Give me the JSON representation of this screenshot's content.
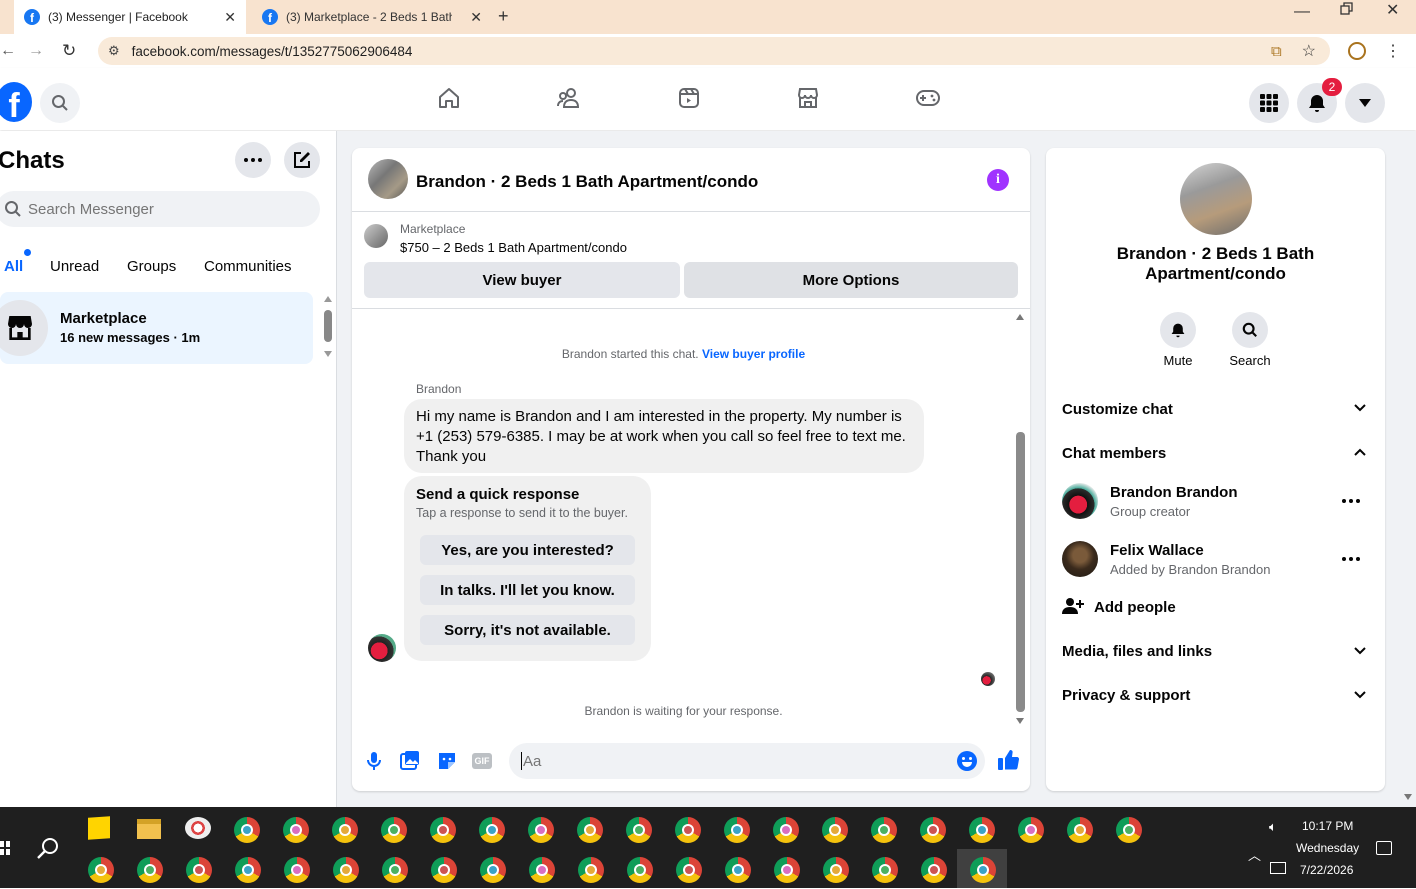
{
  "browser": {
    "tabs": [
      {
        "title": "(3) Messenger | Facebook",
        "active": true
      },
      {
        "title": "(3) Marketplace - 2 Beds 1 Bath"
      }
    ],
    "new_tab": "+",
    "url": "facebook.com/messages/t/1352775062906484"
  },
  "header": {
    "notification_count": "2",
    "nav_icons": [
      "home-icon",
      "friends-icon",
      "video-icon",
      "marketplace-icon",
      "gaming-icon"
    ]
  },
  "left": {
    "title": "Chats",
    "search_placeholder": "Search Messenger",
    "filters": [
      "All",
      "Unread",
      "Groups",
      "Communities"
    ],
    "conversation": {
      "name": "Marketplace",
      "subtitle": "16 new messages · 1m"
    }
  },
  "chat": {
    "title": "Brandon · 2 Beds 1 Bath Apartment/condo",
    "listing": {
      "label": "Marketplace",
      "price_title": "$750 – 2 Beds 1 Bath Apartment/condo"
    },
    "view_buyer": "View buyer",
    "more_options": "More Options",
    "started_text": "Brandon started this chat.",
    "buyer_profile_link": "View buyer profile",
    "sender": "Brandon",
    "message_lines": [
      "Hi my name is Brandon and I am interested in the property. My number is",
      "+1 (253) 579-6385. I may be at work when you call so feel free to text me.",
      "Thank you"
    ],
    "quick_response_title": "Send a quick response",
    "quick_response_sub": "Tap a response to send it to the buyer.",
    "quick_responses": [
      "Yes, are you interested?",
      "In talks. I'll let you know.",
      "Sorry, it's not available."
    ],
    "waiting": "Brandon is waiting for your response.",
    "composer_placeholder": "Aa"
  },
  "info": {
    "title_line1": "Brandon · 2 Beds 1 Bath",
    "title_line2": "Apartment/condo",
    "mute": "Mute",
    "search": "Search",
    "customize": "Customize chat",
    "members_label": "Chat members",
    "members": [
      {
        "name": "Brandon Brandon",
        "role": "Group creator"
      },
      {
        "name": "Felix Wallace",
        "role": "Added by Brandon Brandon"
      }
    ],
    "add_people": "Add people",
    "media": "Media, files and links",
    "privacy": "Privacy & support"
  },
  "taskbar": {
    "time": "10:17 PM",
    "day": "Wednesday",
    "date": "7/22/2026"
  },
  "colors": {
    "fb_blue": "#0866ff",
    "purple_info": "#a033ff",
    "notif_red": "#e41e3f"
  }
}
